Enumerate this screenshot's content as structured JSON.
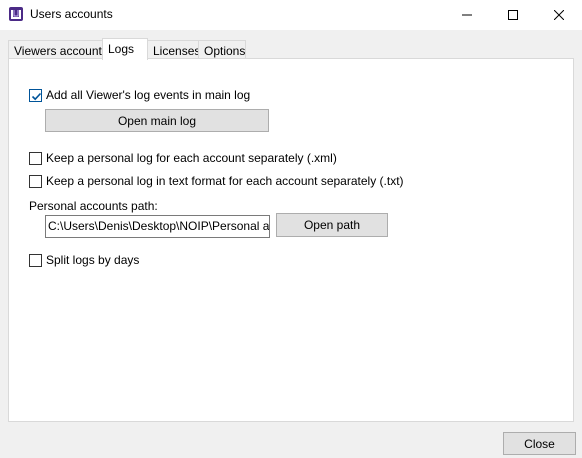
{
  "window": {
    "title": "Users accounts",
    "controls": [
      "minimize",
      "maximize",
      "close"
    ]
  },
  "tabs": [
    {
      "label": "Viewers accounts",
      "active": false
    },
    {
      "label": "Logs",
      "active": true
    },
    {
      "label": "Licenses",
      "active": false
    },
    {
      "label": "Options",
      "active": false
    }
  ],
  "logs": {
    "add_all_events": {
      "label": "Add all Viewer's log events in main log",
      "checked": true
    },
    "open_main_log_button": "Open main log",
    "personal_log_xml": {
      "label": "Keep a personal log for each account separately (.xml)",
      "checked": false
    },
    "personal_log_txt": {
      "label": "Keep a personal log in text format for each account separately (.txt)",
      "checked": false
    },
    "path_label": "Personal accounts path:",
    "path_value": "C:\\Users\\Denis\\Desktop\\NOIP\\Personal accou",
    "open_path_button": "Open path",
    "split_by_days": {
      "label": "Split logs by days",
      "checked": false
    }
  },
  "footer": {
    "close_button": "Close"
  },
  "colors": {
    "accent": "#005499",
    "app_icon": "#4b2a86"
  }
}
